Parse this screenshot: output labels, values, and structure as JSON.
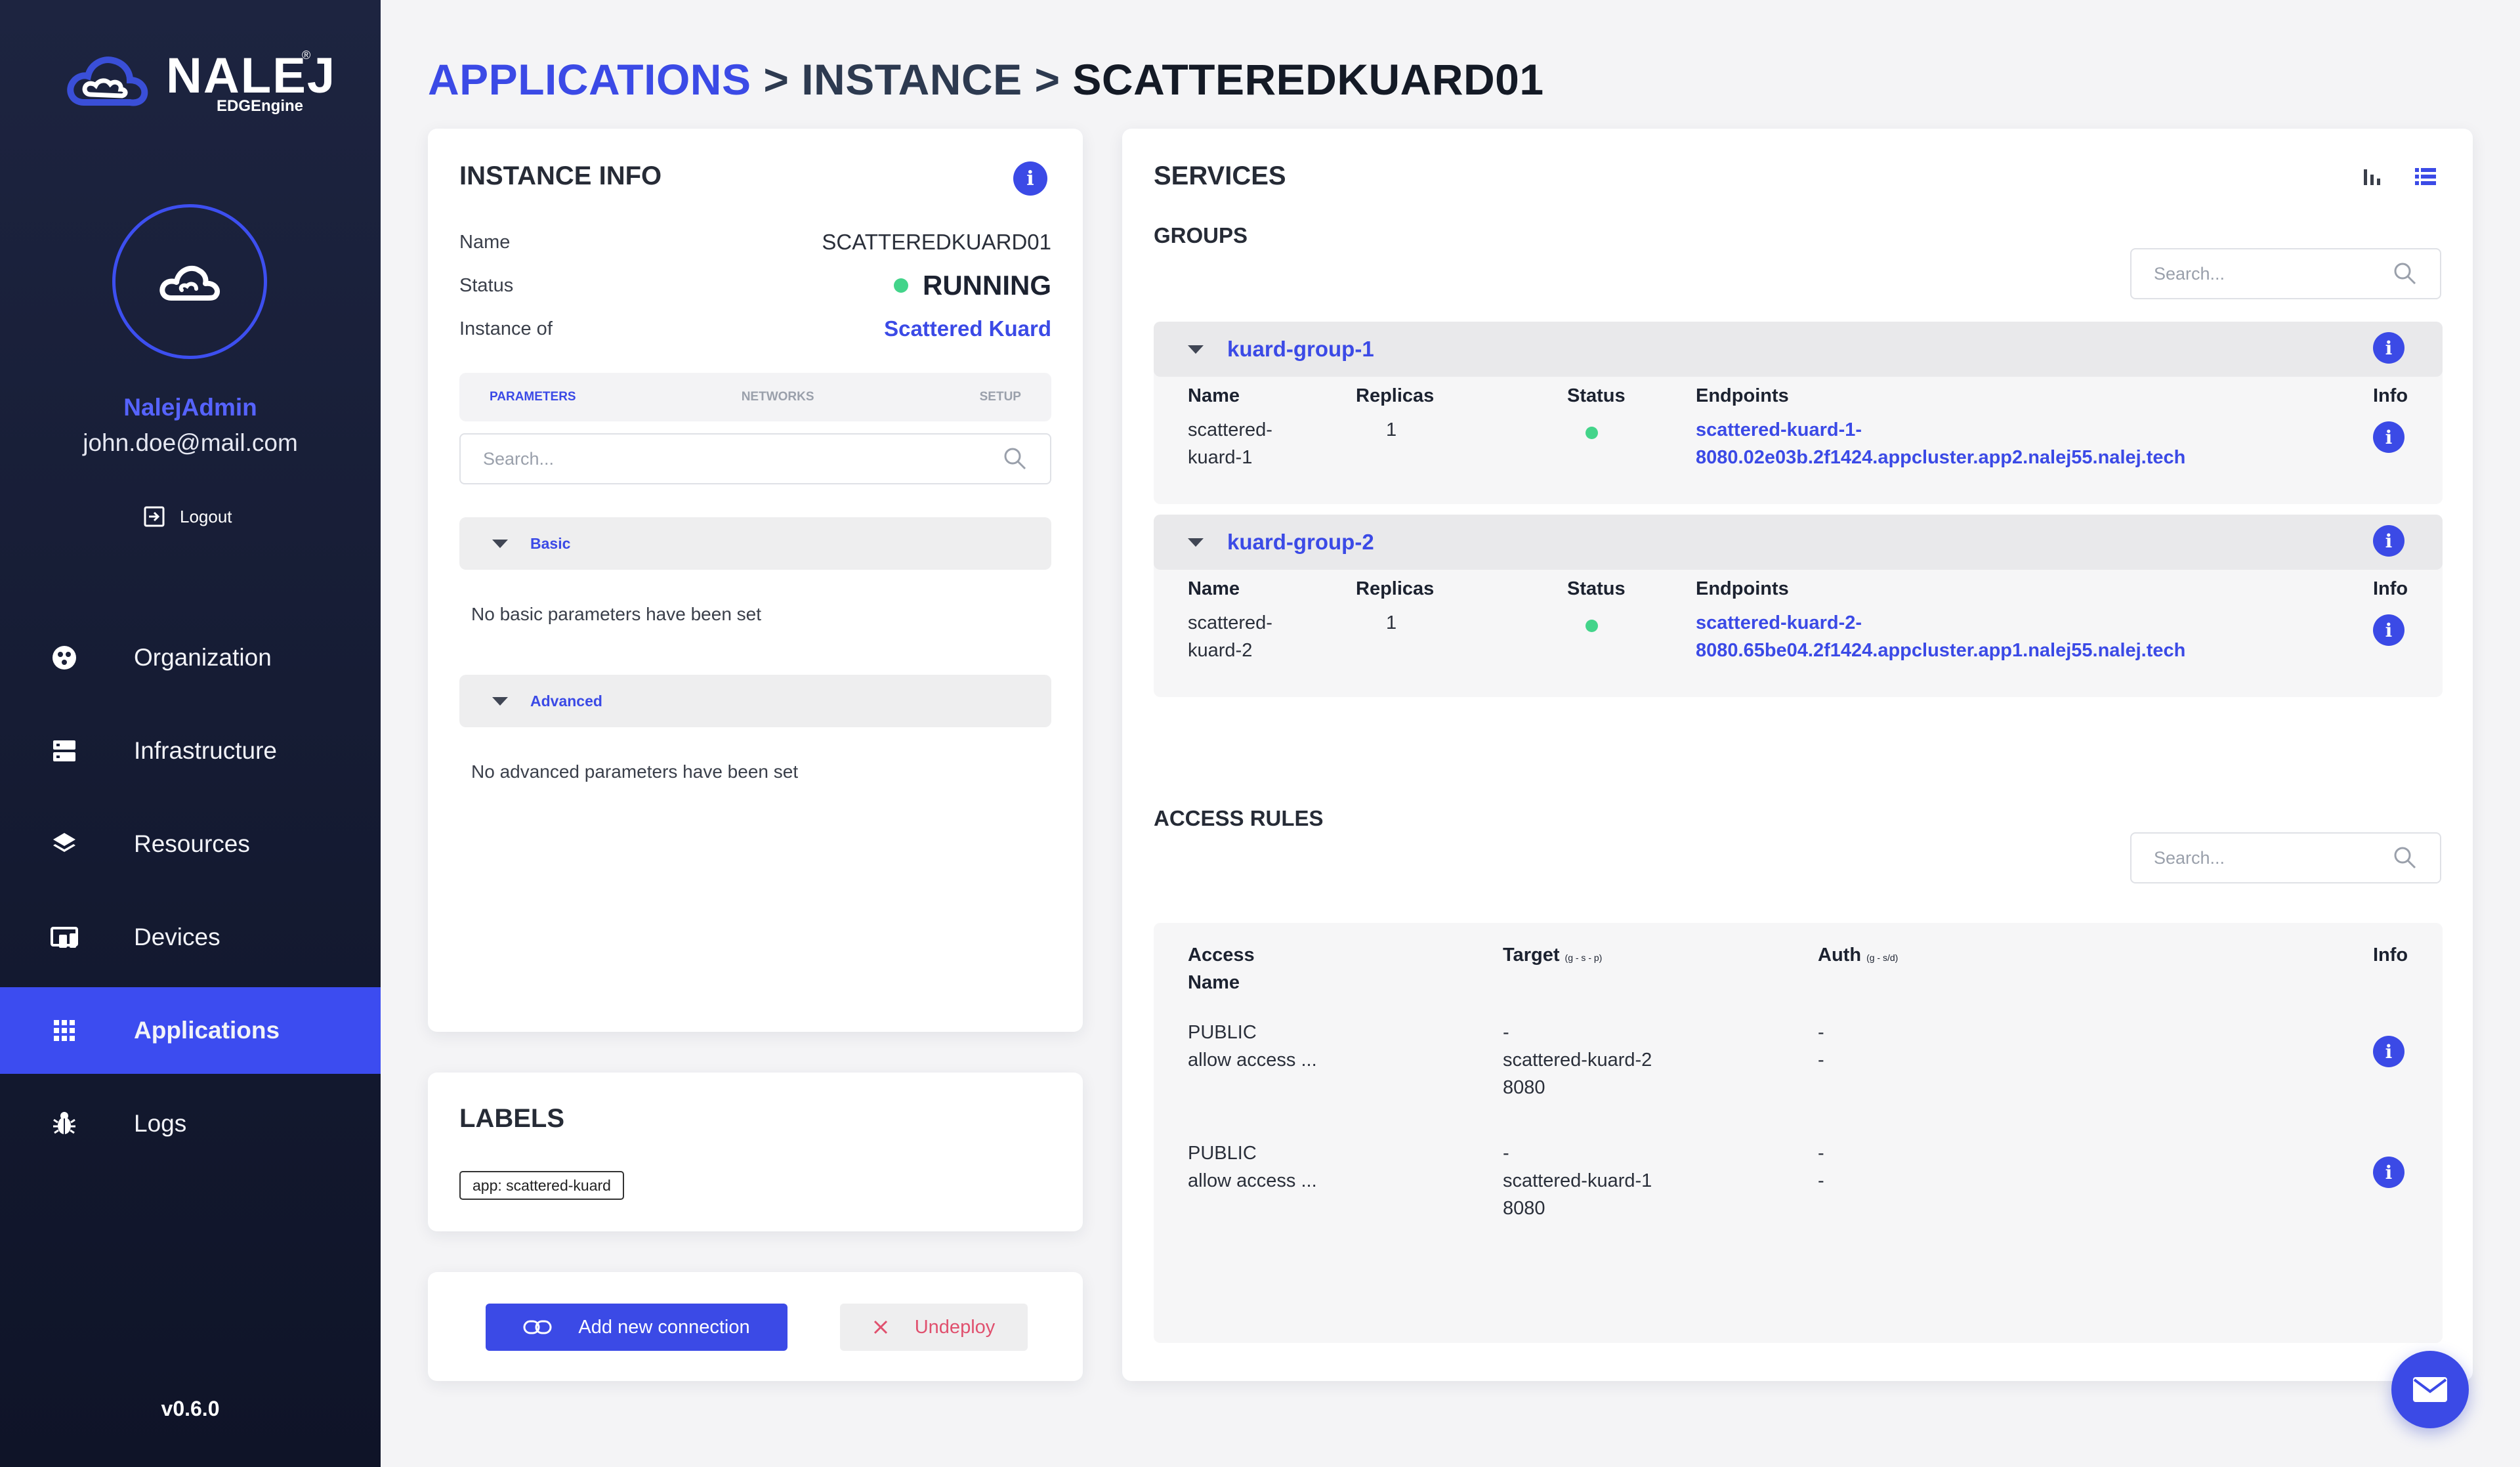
{
  "brand": {
    "name": "NALEJ",
    "trademark": "®",
    "product": "EDGEngine"
  },
  "user": {
    "name": "NalejAdmin",
    "email": "john.doe@mail.com",
    "logout_label": "Logout"
  },
  "nav": [
    {
      "label": "Organization",
      "icon": "organization-icon"
    },
    {
      "label": "Infrastructure",
      "icon": "server-icon"
    },
    {
      "label": "Resources",
      "icon": "layers-icon"
    },
    {
      "label": "Devices",
      "icon": "devices-icon"
    },
    {
      "label": "Applications",
      "icon": "grid-icon",
      "active": true
    },
    {
      "label": "Logs",
      "icon": "bug-icon"
    }
  ],
  "version": "v0.6.0",
  "breadcrumb": {
    "level1": "APPLICATIONS",
    "sep": ">",
    "level2": "INSTANCE",
    "level3": "SCATTEREDKUARD01"
  },
  "instance_info": {
    "title": "INSTANCE INFO",
    "name_label": "Name",
    "name_value": "SCATTEREDKUARD01",
    "status_label": "Status",
    "status_value": "RUNNING",
    "instance_of_label": "Instance of",
    "instance_of_value": "Scattered Kuard",
    "tabs": [
      "PARAMETERS",
      "NETWORKS",
      "SETUP"
    ],
    "search_placeholder": "Search...",
    "basic_label": "Basic",
    "basic_empty": "No basic parameters have been set",
    "advanced_label": "Advanced",
    "advanced_empty": "No advanced parameters have been set"
  },
  "labels": {
    "title": "LABELS",
    "chips": [
      "app: scattered-kuard"
    ]
  },
  "actions": {
    "add_connection": "Add new connection",
    "undeploy": "Undeploy"
  },
  "services": {
    "title": "SERVICES",
    "groups_title": "GROUPS",
    "search_placeholder": "Search...",
    "columns": {
      "name": "Name",
      "replicas": "Replicas",
      "status": "Status",
      "endpoints": "Endpoints",
      "info": "Info"
    },
    "groups": [
      {
        "name": "kuard-group-1",
        "row": {
          "name_1": "scattered-",
          "name_2": "kuard-1",
          "replicas": "1",
          "endpoint_1": "scattered-kuard-1-",
          "endpoint_2": "8080.02e03b.2f1424.appcluster.app2.nalej55.nalej.tech"
        }
      },
      {
        "name": "kuard-group-2",
        "row": {
          "name_1": "scattered-",
          "name_2": "kuard-2",
          "replicas": "1",
          "endpoint_1": "scattered-kuard-2-",
          "endpoint_2": "8080.65be04.2f1424.appcluster.app1.nalej55.nalej.tech"
        }
      }
    ],
    "access_rules_title": "ACCESS RULES",
    "rules_search_placeholder": "Search...",
    "rules_columns": {
      "access_1": "Access",
      "access_2": "Name",
      "target": "Target",
      "target_note": "(g - s - p)",
      "auth": "Auth",
      "auth_note": "(g - s/d)",
      "info": "Info"
    },
    "rules": [
      {
        "access": "PUBLIC",
        "name": "allow access ...",
        "target_1": "-",
        "target_2": "scattered-kuard-2",
        "target_3": "8080",
        "auth_1": "-",
        "auth_2": "-"
      },
      {
        "access": "PUBLIC",
        "name": "allow access ...",
        "target_1": "-",
        "target_2": "scattered-kuard-1",
        "target_3": "8080",
        "auth_1": "-",
        "auth_2": "-"
      }
    ]
  },
  "colors": {
    "accent": "#3b4ae6",
    "sidebar_bg": "#1a2039",
    "status_running": "#43d48a",
    "danger": "#e0506e"
  }
}
